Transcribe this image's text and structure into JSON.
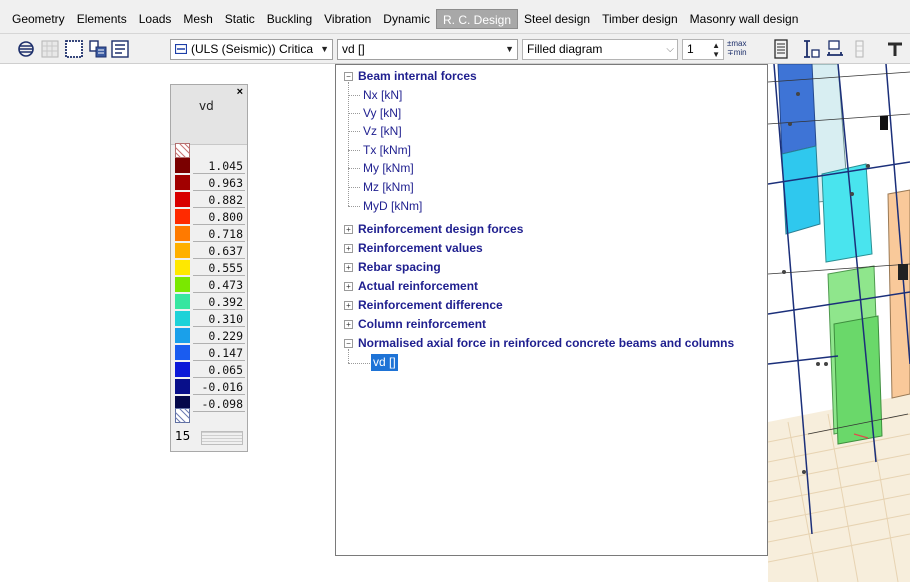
{
  "tabs": [
    "Geometry",
    "Elements",
    "Loads",
    "Mesh",
    "Static",
    "Buckling",
    "Vibration",
    "Dynamic",
    "R. C. Design",
    "Steel design",
    "Timber design",
    "Masonry wall design"
  ],
  "active_tab": "R. C. Design",
  "toolbar": {
    "load_case_combo": "(ULS (Seismic)) Critica",
    "result_combo": "vd []",
    "display_combo": "Filled diagram",
    "scale_value": "1",
    "max_label": "max",
    "min_label": "min"
  },
  "legend": {
    "title": "vd",
    "close_glyph": "×",
    "values": [
      "1.045",
      "0.963",
      "0.882",
      "0.800",
      "0.718",
      "0.637",
      "0.555",
      "0.473",
      "0.392",
      "0.310",
      "0.229",
      "0.147",
      "0.065",
      "-0.016",
      "-0.098"
    ],
    "colors": [
      "#7a0000",
      "#a10000",
      "#d80000",
      "#ff2a00",
      "#ff7a00",
      "#ffb000",
      "#ffe800",
      "#7ae800",
      "#37e6a0",
      "#1ed2d8",
      "#1aa0ea",
      "#1a5cf0",
      "#0a18d8",
      "#080f8a",
      "#04084a"
    ],
    "count": "15"
  },
  "tree": {
    "groups": [
      {
        "label": "Beam internal forces",
        "expanded": true,
        "children": [
          "Nx [kN]",
          "Vy [kN]",
          "Vz [kN]",
          "Tx [kNm]",
          "My [kNm]",
          "Mz [kNm]",
          "MyD [kNm]"
        ]
      },
      {
        "label": "Reinforcement design forces",
        "expanded": false
      },
      {
        "label": "Reinforcement values",
        "expanded": false
      },
      {
        "label": "Rebar spacing",
        "expanded": false
      },
      {
        "label": "Actual reinforcement",
        "expanded": false
      },
      {
        "label": "Reinforcement difference",
        "expanded": false
      },
      {
        "label": "Column reinforcement",
        "expanded": false
      },
      {
        "label": "Normalised axial force in reinforced concrete beams and columns",
        "expanded": true,
        "children": [
          "vd []"
        ]
      }
    ],
    "selected": "vd []"
  }
}
